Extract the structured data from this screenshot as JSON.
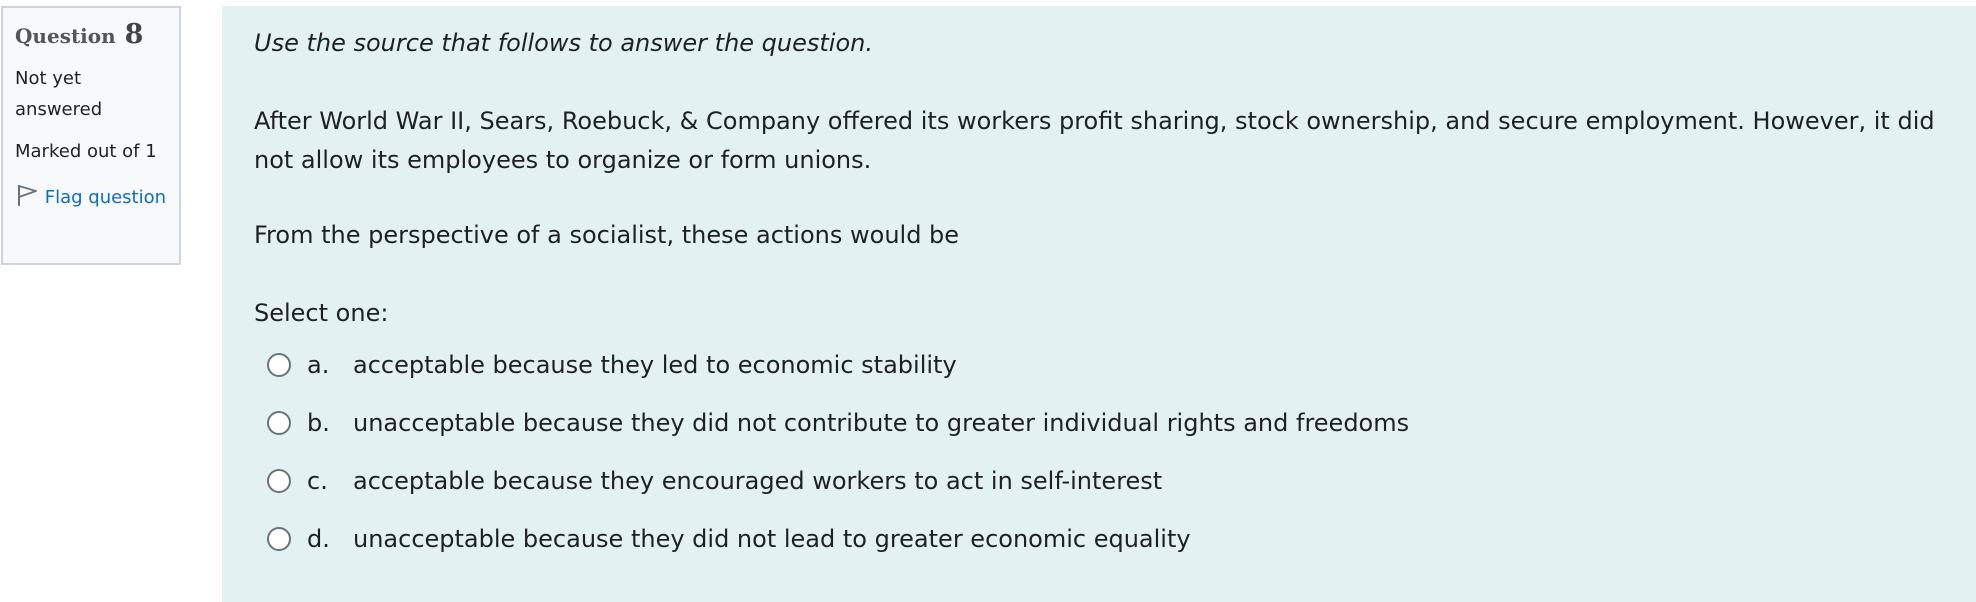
{
  "info": {
    "question_label": "Question",
    "question_number": "8",
    "status": "Not yet answered",
    "grade": "Marked out of 1",
    "flag_label": "Flag question"
  },
  "question": {
    "intro": "Use the source that follows to answer the question.",
    "source": "After World War II, Sears, Roebuck, & Company offered its workers profit sharing, stock ownership, and secure employment. However, it did not allow its employees to organize or form unions.",
    "prompt": "From the perspective of a socialist, these actions would be",
    "select_label": "Select one:",
    "answers": [
      {
        "letter": "a.",
        "text": "acceptable because they led to economic stability"
      },
      {
        "letter": "b.",
        "text": "unacceptable because they did not contribute to greater individual rights and freedoms"
      },
      {
        "letter": "c.",
        "text": "acceptable because they encouraged workers to act in self-interest"
      },
      {
        "letter": "d.",
        "text": "unacceptable because they did not lead to greater economic equality"
      }
    ]
  },
  "colors": {
    "content_bg": "#e3f1f3",
    "info_bg": "#f8f9fa",
    "link": "#0f6cbf"
  },
  "icons": {
    "flag": "flag-outline-icon",
    "radio": "radio-unchecked"
  }
}
